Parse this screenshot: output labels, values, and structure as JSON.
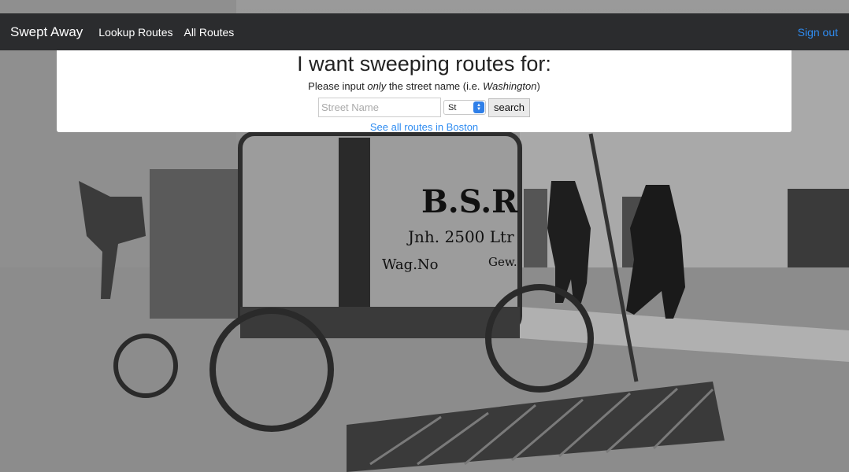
{
  "navbar": {
    "brand": "Swept Away",
    "links": [
      "Lookup Routes",
      "All Routes"
    ],
    "signout": "Sign out"
  },
  "search": {
    "headline": "I want sweeping routes for:",
    "instruction_before": "Please input ",
    "instruction_em": "only",
    "instruction_middle": " the street name (i.e. ",
    "instruction_example": "Washington",
    "instruction_after": ")",
    "placeholder": "Street Name",
    "suffix_selected": "St",
    "button": "search",
    "all_routes_link": "See all routes in Boston"
  },
  "background": {
    "cart_lettering": [
      "B.S.R",
      "Jnh. 2500 Ltr",
      "Wag.No",
      "Gew."
    ]
  },
  "colors": {
    "navbar": "#2b2c2e",
    "link": "#2f8cf1",
    "select_accent": "#2f7fe8"
  }
}
